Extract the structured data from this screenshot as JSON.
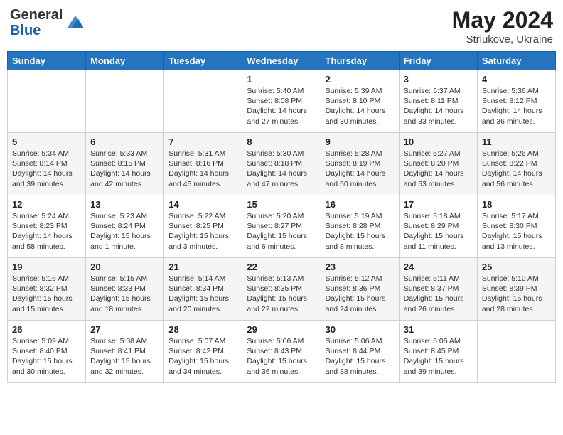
{
  "header": {
    "logo_general": "General",
    "logo_blue": "Blue",
    "title": "May 2024",
    "location": "Striukove, Ukraine"
  },
  "columns": [
    "Sunday",
    "Monday",
    "Tuesday",
    "Wednesday",
    "Thursday",
    "Friday",
    "Saturday"
  ],
  "weeks": [
    {
      "days": [
        {
          "num": "",
          "info": ""
        },
        {
          "num": "",
          "info": ""
        },
        {
          "num": "",
          "info": ""
        },
        {
          "num": "1",
          "info": "Sunrise: 5:40 AM\nSunset: 8:08 PM\nDaylight: 14 hours\nand 27 minutes."
        },
        {
          "num": "2",
          "info": "Sunrise: 5:39 AM\nSunset: 8:10 PM\nDaylight: 14 hours\nand 30 minutes."
        },
        {
          "num": "3",
          "info": "Sunrise: 5:37 AM\nSunset: 8:11 PM\nDaylight: 14 hours\nand 33 minutes."
        },
        {
          "num": "4",
          "info": "Sunrise: 5:36 AM\nSunset: 8:12 PM\nDaylight: 14 hours\nand 36 minutes."
        }
      ]
    },
    {
      "days": [
        {
          "num": "5",
          "info": "Sunrise: 5:34 AM\nSunset: 8:14 PM\nDaylight: 14 hours\nand 39 minutes."
        },
        {
          "num": "6",
          "info": "Sunrise: 5:33 AM\nSunset: 8:15 PM\nDaylight: 14 hours\nand 42 minutes."
        },
        {
          "num": "7",
          "info": "Sunrise: 5:31 AM\nSunset: 8:16 PM\nDaylight: 14 hours\nand 45 minutes."
        },
        {
          "num": "8",
          "info": "Sunrise: 5:30 AM\nSunset: 8:18 PM\nDaylight: 14 hours\nand 47 minutes."
        },
        {
          "num": "9",
          "info": "Sunrise: 5:28 AM\nSunset: 8:19 PM\nDaylight: 14 hours\nand 50 minutes."
        },
        {
          "num": "10",
          "info": "Sunrise: 5:27 AM\nSunset: 8:20 PM\nDaylight: 14 hours\nand 53 minutes."
        },
        {
          "num": "11",
          "info": "Sunrise: 5:26 AM\nSunset: 8:22 PM\nDaylight: 14 hours\nand 56 minutes."
        }
      ]
    },
    {
      "days": [
        {
          "num": "12",
          "info": "Sunrise: 5:24 AM\nSunset: 8:23 PM\nDaylight: 14 hours\nand 58 minutes."
        },
        {
          "num": "13",
          "info": "Sunrise: 5:23 AM\nSunset: 8:24 PM\nDaylight: 15 hours\nand 1 minute."
        },
        {
          "num": "14",
          "info": "Sunrise: 5:22 AM\nSunset: 8:25 PM\nDaylight: 15 hours\nand 3 minutes."
        },
        {
          "num": "15",
          "info": "Sunrise: 5:20 AM\nSunset: 8:27 PM\nDaylight: 15 hours\nand 6 minutes."
        },
        {
          "num": "16",
          "info": "Sunrise: 5:19 AM\nSunset: 8:28 PM\nDaylight: 15 hours\nand 8 minutes."
        },
        {
          "num": "17",
          "info": "Sunrise: 5:18 AM\nSunset: 8:29 PM\nDaylight: 15 hours\nand 11 minutes."
        },
        {
          "num": "18",
          "info": "Sunrise: 5:17 AM\nSunset: 8:30 PM\nDaylight: 15 hours\nand 13 minutes."
        }
      ]
    },
    {
      "days": [
        {
          "num": "19",
          "info": "Sunrise: 5:16 AM\nSunset: 8:32 PM\nDaylight: 15 hours\nand 15 minutes."
        },
        {
          "num": "20",
          "info": "Sunrise: 5:15 AM\nSunset: 8:33 PM\nDaylight: 15 hours\nand 18 minutes."
        },
        {
          "num": "21",
          "info": "Sunrise: 5:14 AM\nSunset: 8:34 PM\nDaylight: 15 hours\nand 20 minutes."
        },
        {
          "num": "22",
          "info": "Sunrise: 5:13 AM\nSunset: 8:35 PM\nDaylight: 15 hours\nand 22 minutes."
        },
        {
          "num": "23",
          "info": "Sunrise: 5:12 AM\nSunset: 8:36 PM\nDaylight: 15 hours\nand 24 minutes."
        },
        {
          "num": "24",
          "info": "Sunrise: 5:11 AM\nSunset: 8:37 PM\nDaylight: 15 hours\nand 26 minutes."
        },
        {
          "num": "25",
          "info": "Sunrise: 5:10 AM\nSunset: 8:39 PM\nDaylight: 15 hours\nand 28 minutes."
        }
      ]
    },
    {
      "days": [
        {
          "num": "26",
          "info": "Sunrise: 5:09 AM\nSunset: 8:40 PM\nDaylight: 15 hours\nand 30 minutes."
        },
        {
          "num": "27",
          "info": "Sunrise: 5:08 AM\nSunset: 8:41 PM\nDaylight: 15 hours\nand 32 minutes."
        },
        {
          "num": "28",
          "info": "Sunrise: 5:07 AM\nSunset: 8:42 PM\nDaylight: 15 hours\nand 34 minutes."
        },
        {
          "num": "29",
          "info": "Sunrise: 5:06 AM\nSunset: 8:43 PM\nDaylight: 15 hours\nand 36 minutes."
        },
        {
          "num": "30",
          "info": "Sunrise: 5:06 AM\nSunset: 8:44 PM\nDaylight: 15 hours\nand 38 minutes."
        },
        {
          "num": "31",
          "info": "Sunrise: 5:05 AM\nSunset: 8:45 PM\nDaylight: 15 hours\nand 39 minutes."
        },
        {
          "num": "",
          "info": ""
        }
      ]
    }
  ]
}
